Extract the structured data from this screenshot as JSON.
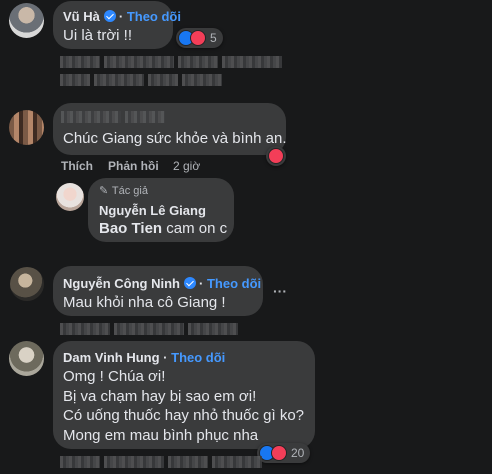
{
  "comments": [
    {
      "name": "Vũ Hà",
      "follow": "Theo dõi",
      "text": "Ui là trời !!",
      "reactions": "5"
    },
    {
      "text": "Chúc Giang sức khỏe và bình an.",
      "actions": {
        "like": "Thích",
        "reply": "Phản hồi",
        "time": "2 giờ"
      }
    },
    {
      "author_badge": "Tác giả",
      "name": "Nguyễn Lê Giang",
      "mention": "Bao Tien",
      "text": "cam on c"
    },
    {
      "name": "Nguyễn Công Ninh",
      "follow": "Theo dõi",
      "text": "Mau khỏi nha cô Giang !",
      "more": "···"
    },
    {
      "name": "Dam Vinh Hung",
      "follow": "Theo dõi",
      "lines": [
        "Omg ! Chúa ơi!",
        "Bị va chạm hay bị sao em ơi!",
        "Có uống thuốc hay nhỏ thuốc gì ko?",
        "Mong em mau bình phục nha"
      ],
      "reactions": "20"
    }
  ],
  "colors": {
    "bg": "#18191a",
    "bubble": "#3a3b3c",
    "link": "#4599ff",
    "like": "#1877f2",
    "love": "#f33e58"
  }
}
